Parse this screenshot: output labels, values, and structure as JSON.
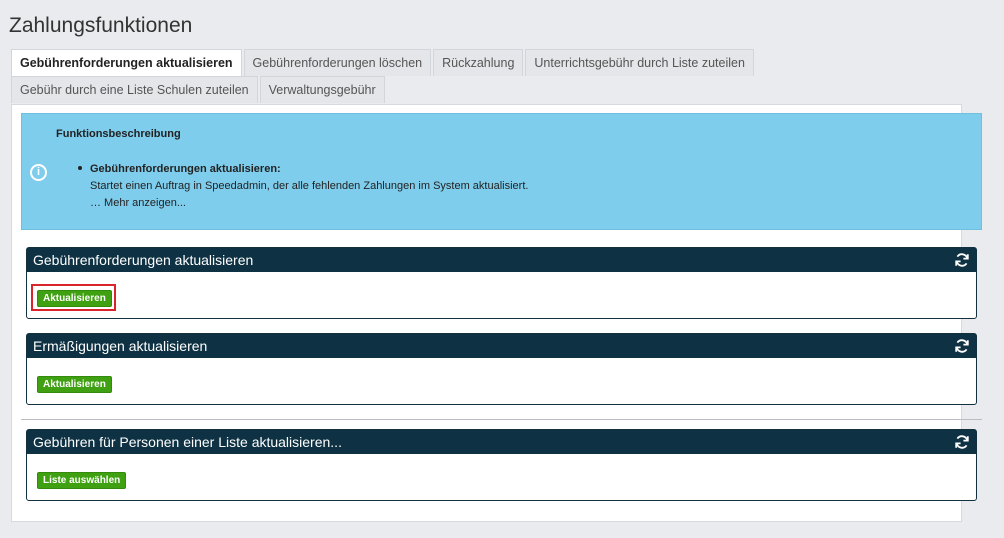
{
  "page": {
    "title": "Zahlungsfunktionen"
  },
  "tabs": [
    {
      "label": "Gebührenforderungen aktualisieren",
      "active": true
    },
    {
      "label": "Gebührenforderungen löschen",
      "active": false
    },
    {
      "label": "Rückzahlung",
      "active": false
    },
    {
      "label": "Unterrichtsgebühr durch Liste zuteilen",
      "active": false
    },
    {
      "label": "Gebühr durch eine Liste Schulen zuteilen",
      "active": false
    },
    {
      "label": "Verwaltungsgebühr",
      "active": false
    }
  ],
  "info": {
    "icon": "info-circle-icon",
    "title": "Funktionsbeschreibung",
    "item_title": "Gebührenforderungen aktualisieren:",
    "item_text": "Startet einen Auftrag in Speedadmin, der alle fehlenden Zahlungen im System aktualisiert.",
    "more": "… Mehr anzeigen..."
  },
  "cards": [
    {
      "title": "Gebührenforderungen aktualisieren",
      "button": "Aktualisieren",
      "highlighted": true
    },
    {
      "title": "Ermäßigungen aktualisieren",
      "button": "Aktualisieren",
      "highlighted": false
    },
    {
      "title": "Gebühren für Personen einer Liste aktualisieren...",
      "button": "Liste auswählen",
      "highlighted": false
    }
  ],
  "colors": {
    "info_bg": "#7fcdec",
    "card_header": "#0e3243",
    "button_green": "#3fa012",
    "highlight_red": "#d9242a"
  }
}
